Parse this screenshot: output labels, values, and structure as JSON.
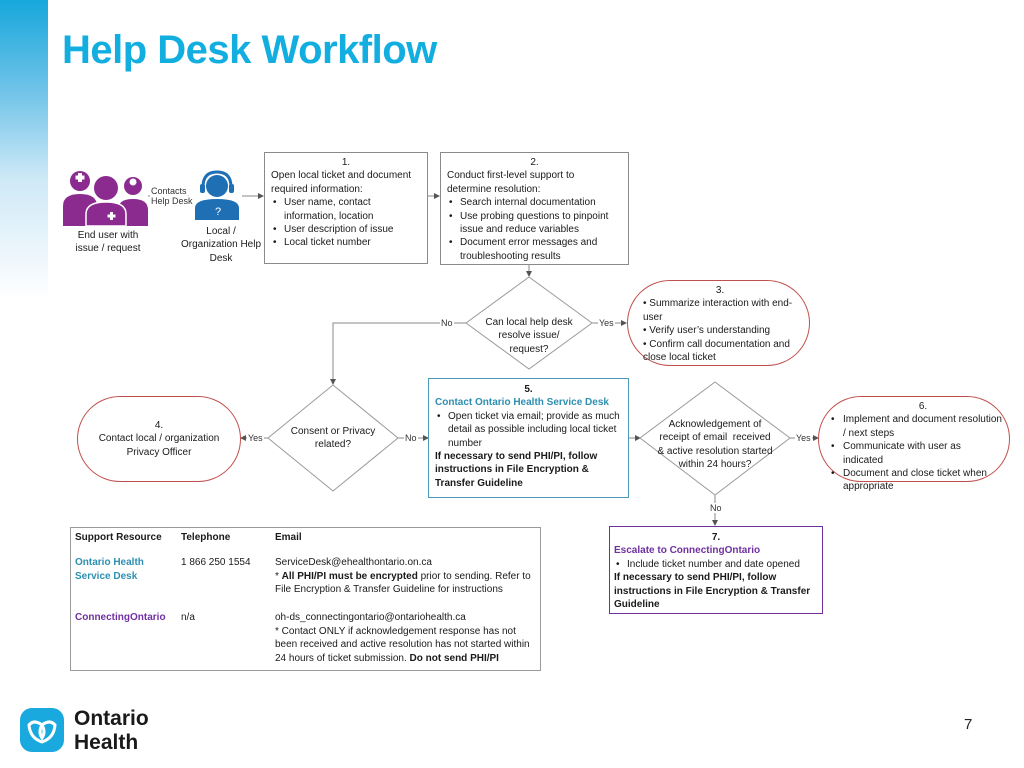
{
  "title": "Help Desk Workflow",
  "colors": {
    "title": "#12aee0",
    "end_user_icon": "#8b2a8f",
    "help_desk_icon": "#1f6fb5",
    "pill_border": "#c0504d",
    "box5_border": "#4a9bb5",
    "box7_border": "#7030a0",
    "teal_text": "#2e8fb0",
    "purple_text": "#7030a0"
  },
  "actors": {
    "end_user": {
      "icon": "group-of-people-icon",
      "label_line1": "End user with",
      "label_line2": "issue / request"
    },
    "contacts_label_line1": "Contacts",
    "contacts_label_line2": "Help Desk",
    "help_desk": {
      "icon": "headset-agent-icon",
      "label_line1": "Local /",
      "label_line2": "Organization Help",
      "label_line3": "Desk"
    }
  },
  "steps": {
    "s1": {
      "number": "1.",
      "heading_line1": "Open local ticket and document",
      "heading_line2": "required information:",
      "bullets": [
        "User name, contact information, location",
        "User description of issue",
        "Local ticket number"
      ]
    },
    "s2": {
      "number": "2.",
      "heading_line1": "Conduct first-level support to",
      "heading_line2": "determine resolution:",
      "bullets": [
        "Search internal documentation",
        "Use probing questions to pinpoint issue and reduce variables",
        "Document error messages and troubleshooting results"
      ]
    },
    "s3": {
      "number": "3.",
      "bullets": [
        "Summarize interaction with end-user",
        "Verify user’s understanding",
        "Confirm call documentation and close local ticket"
      ]
    },
    "s4": {
      "number": "4.",
      "line1": "Contact local / organization",
      "line2": "Privacy Officer"
    },
    "s5": {
      "number": "5.",
      "heading": "Contact Ontario Health Service Desk",
      "bullets": [
        "Open ticket via email; provide as much detail as possible including local ticket number"
      ],
      "note": "If necessary to send PHI/PI, follow instructions in File Encryption & Transfer Guideline"
    },
    "s6": {
      "number": "6.",
      "bullets": [
        "Implement and document resolution / next steps",
        "Communicate with user as indicated",
        "Document and close ticket when appropriate"
      ]
    },
    "s7": {
      "number": "7.",
      "heading": "Escalate to ConnectingOntario",
      "bullets": [
        "Include ticket number and date opened"
      ],
      "note": "If necessary to send PHI/PI, follow instructions in File Encryption & Transfer Guideline"
    }
  },
  "decisions": {
    "d1": {
      "line1": "Can local help desk",
      "line2": "resolve issue/",
      "line3": "request?"
    },
    "d2": {
      "line1": "Consent or Privacy",
      "line2": "related?"
    },
    "d3": {
      "line1": "Acknowledgement of",
      "line2": "receipt of email  received",
      "line3": "& active resolution started",
      "line4": "within 24 hours?"
    }
  },
  "edge_labels": {
    "yes": "Yes",
    "no": "No"
  },
  "support_table": {
    "headers": [
      "Support Resource",
      "Telephone",
      "Email"
    ],
    "rows": [
      {
        "resource_line1": "Ontario Health",
        "resource_line2": "Service Desk",
        "telephone": "1 866 250 1554",
        "email": "ServiceDesk@ehealthontario.on.ca",
        "note_prefix": "* ",
        "note_bold": "All PHI/PI must be encrypted",
        "note_rest": " prior to sending. Refer to File Encryption & Transfer Guideline for instructions"
      },
      {
        "resource_line1": "ConnectingOntario",
        "telephone": "n/a",
        "email": "oh-ds_connectingontario@ontariohealth.ca",
        "note_rest": "* Contact ONLY if acknowledgement response has not been received and active resolution has not started within 24 hours of ticket submission. ",
        "note_bold": "Do not send PHI/PI"
      }
    ]
  },
  "footer": {
    "logo_icon": "ontario-trillium-icon",
    "logo_line1": "Ontario",
    "logo_line2": "Health",
    "page_number": "7"
  }
}
